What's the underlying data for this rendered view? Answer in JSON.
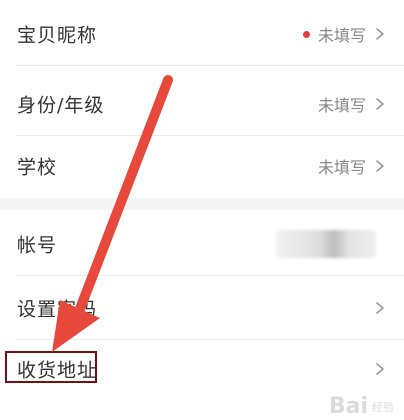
{
  "profile": {
    "rows": [
      {
        "label": "宝贝昵称",
        "value": "未填写",
        "has_red_dot": true
      },
      {
        "label": "身份/年级",
        "value": "未填写"
      },
      {
        "label": "学校",
        "value": "未填写"
      }
    ]
  },
  "account": {
    "rows": [
      {
        "label": "帐号",
        "value_blurred": true
      },
      {
        "label": "设置密码"
      },
      {
        "label": "收货地址"
      }
    ]
  },
  "annotation": {
    "arrow_color": "#e8493d",
    "box_color": "#7a0f0f"
  },
  "watermark": {
    "brand": "Bai",
    "sub": "经验"
  },
  "icons": {
    "chevron": "chevron-right-icon",
    "dot": "red-dot-icon"
  },
  "colors": {
    "red_dot": "#e0403a",
    "label": "#333333",
    "value": "#888888",
    "background": "#f4f4f4"
  }
}
